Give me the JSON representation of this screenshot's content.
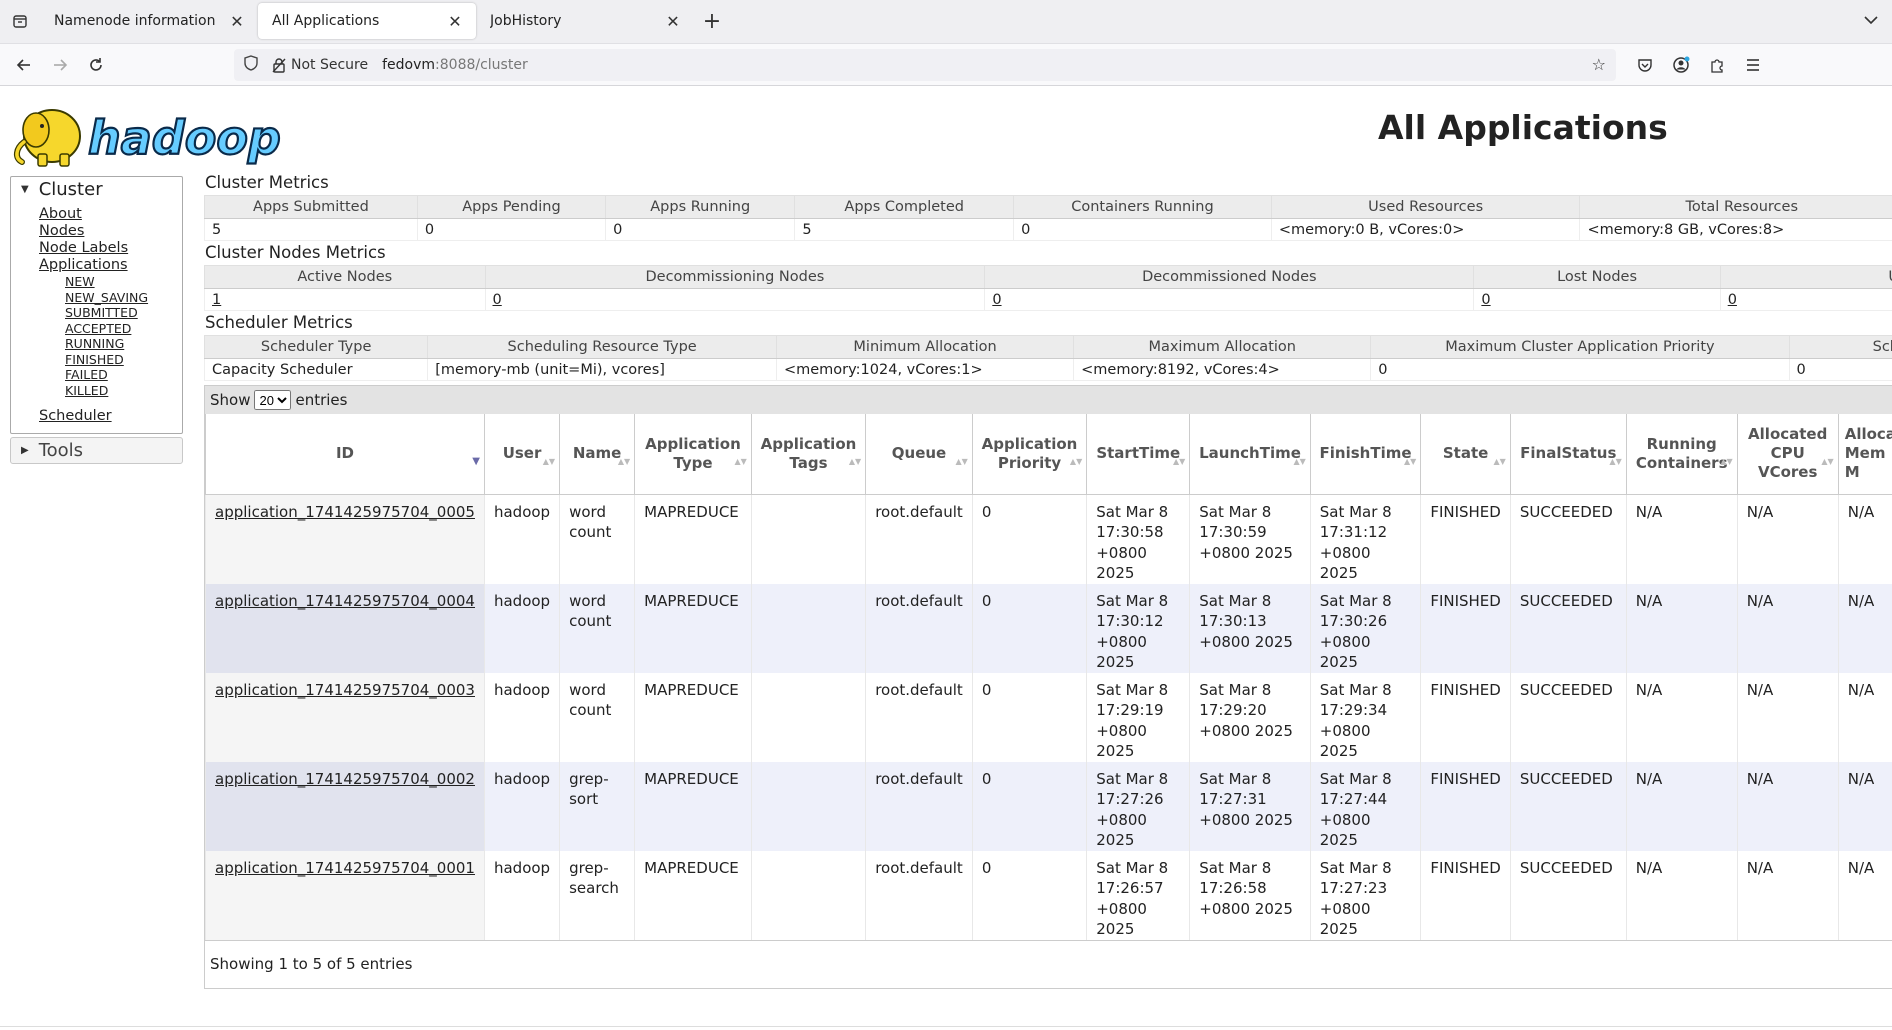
{
  "browser": {
    "tabs": [
      {
        "title": "Namenode information",
        "active": false
      },
      {
        "title": "All Applications",
        "active": true
      },
      {
        "title": "JobHistory",
        "active": false
      }
    ],
    "url_security": "Not Secure",
    "url_host": "fedovm",
    "url_path": ":8088/cluster"
  },
  "page": {
    "title": "All Applications",
    "logo_text": "hadoop"
  },
  "sidebar": {
    "cluster_label": "Cluster",
    "links": {
      "about": "About",
      "nodes": "Nodes",
      "node_labels": "Node Labels",
      "applications": "Applications"
    },
    "app_states": [
      "NEW",
      "NEW_SAVING",
      "SUBMITTED",
      "ACCEPTED",
      "RUNNING",
      "FINISHED",
      "FAILED",
      "KILLED"
    ],
    "scheduler": "Scheduler",
    "tools_label": "Tools"
  },
  "cluster_metrics": {
    "title": "Cluster Metrics",
    "headers": [
      "Apps Submitted",
      "Apps Pending",
      "Apps Running",
      "Apps Completed",
      "Containers Running",
      "Used Resources",
      "Total Resources"
    ],
    "values": [
      "5",
      "0",
      "0",
      "5",
      "0",
      "<memory:0 B, vCores:0>",
      "<memory:8 GB, vCores:8>"
    ]
  },
  "nodes_metrics": {
    "title": "Cluster Nodes Metrics",
    "headers": [
      "Active Nodes",
      "Decommissioning Nodes",
      "Decommissioned Nodes",
      "Lost Nodes",
      "U"
    ],
    "values": [
      "1",
      "0",
      "0",
      "0",
      "0"
    ]
  },
  "scheduler_metrics": {
    "title": "Scheduler Metrics",
    "headers": [
      "Scheduler Type",
      "Scheduling Resource Type",
      "Minimum Allocation",
      "Maximum Allocation",
      "Maximum Cluster Application Priority",
      "Sch"
    ],
    "values": [
      "Capacity Scheduler",
      "[memory-mb (unit=Mi), vcores]",
      "<memory:1024, vCores:1>",
      "<memory:8192, vCores:4>",
      "0",
      "0"
    ]
  },
  "apps_table": {
    "show_label": "Show",
    "page_size": "20",
    "entries_label": "entries",
    "columns": [
      "ID",
      "User",
      "Name",
      "Application Type",
      "Application Tags",
      "Queue",
      "Application Priority",
      "StartTime",
      "LaunchTime",
      "FinishTime",
      "State",
      "FinalStatus",
      "Running Containers",
      "Allocated CPU VCores",
      "Alloca Mem M"
    ],
    "rows": [
      {
        "id": "application_1741425975704_0005",
        "user": "hadoop",
        "name": "word count",
        "type": "MAPREDUCE",
        "tags": "",
        "queue": "root.default",
        "priority": "0",
        "start": "Sat Mar 8 17:30:58 +0800 2025",
        "launch": "Sat Mar 8 17:30:59 +0800 2025",
        "finish": "Sat Mar 8 17:31:12 +0800 2025",
        "state": "FINISHED",
        "final": "SUCCEEDED",
        "running": "N/A",
        "cpu": "N/A",
        "mem": "N/A"
      },
      {
        "id": "application_1741425975704_0004",
        "user": "hadoop",
        "name": "word count",
        "type": "MAPREDUCE",
        "tags": "",
        "queue": "root.default",
        "priority": "0",
        "start": "Sat Mar 8 17:30:12 +0800 2025",
        "launch": "Sat Mar 8 17:30:13 +0800 2025",
        "finish": "Sat Mar 8 17:30:26 +0800 2025",
        "state": "FINISHED",
        "final": "SUCCEEDED",
        "running": "N/A",
        "cpu": "N/A",
        "mem": "N/A"
      },
      {
        "id": "application_1741425975704_0003",
        "user": "hadoop",
        "name": "word count",
        "type": "MAPREDUCE",
        "tags": "",
        "queue": "root.default",
        "priority": "0",
        "start": "Sat Mar 8 17:29:19 +0800 2025",
        "launch": "Sat Mar 8 17:29:20 +0800 2025",
        "finish": "Sat Mar 8 17:29:34 +0800 2025",
        "state": "FINISHED",
        "final": "SUCCEEDED",
        "running": "N/A",
        "cpu": "N/A",
        "mem": "N/A"
      },
      {
        "id": "application_1741425975704_0002",
        "user": "hadoop",
        "name": "grep-sort",
        "type": "MAPREDUCE",
        "tags": "",
        "queue": "root.default",
        "priority": "0",
        "start": "Sat Mar 8 17:27:26 +0800 2025",
        "launch": "Sat Mar 8 17:27:31 +0800 2025",
        "finish": "Sat Mar 8 17:27:44 +0800 2025",
        "state": "FINISHED",
        "final": "SUCCEEDED",
        "running": "N/A",
        "cpu": "N/A",
        "mem": "N/A"
      },
      {
        "id": "application_1741425975704_0001",
        "user": "hadoop",
        "name": "grep-search",
        "type": "MAPREDUCE",
        "tags": "",
        "queue": "root.default",
        "priority": "0",
        "start": "Sat Mar 8 17:26:57 +0800 2025",
        "launch": "Sat Mar 8 17:26:58 +0800 2025",
        "finish": "Sat Mar 8 17:27:23 +0800 2025",
        "state": "FINISHED",
        "final": "SUCCEEDED",
        "running": "N/A",
        "cpu": "N/A",
        "mem": "N/A"
      }
    ],
    "footer": "Showing 1 to 5 of 5 entries"
  },
  "colors": {
    "even_row": "#eef0fa",
    "header_bg": "#ececec",
    "logo_yellow": "#f6d72c",
    "logo_blue": "#66ccff"
  }
}
